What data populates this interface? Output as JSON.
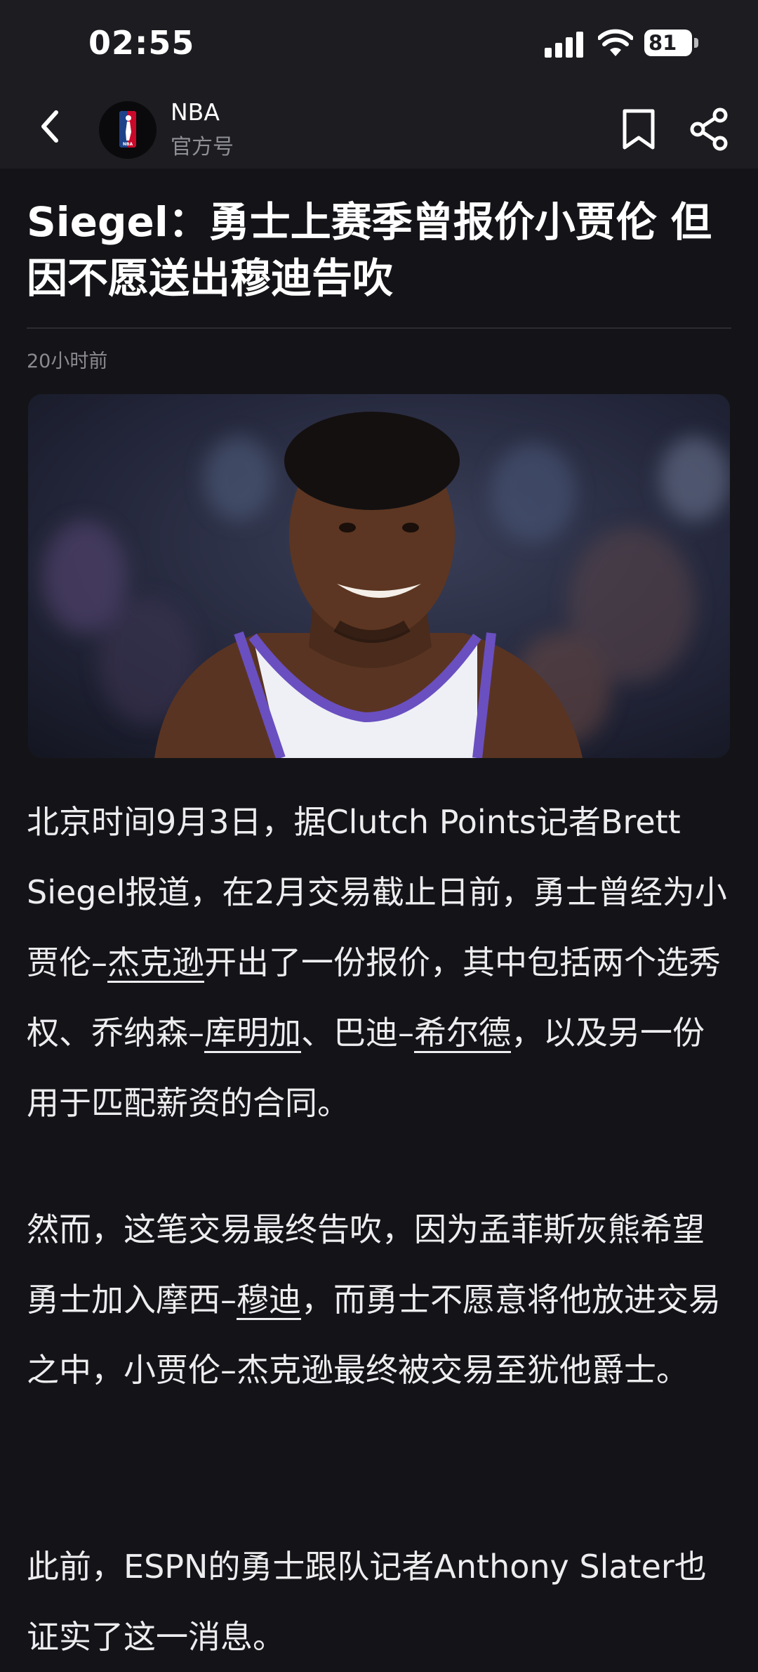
{
  "status_bar": {
    "time": "02:55",
    "battery": "81"
  },
  "nav": {
    "title": "NBA",
    "subtitle": "官方号",
    "logo_text": "NBA"
  },
  "article": {
    "headline": "Siegel：勇士上赛季曾报价小贾伦  但因不愿送出穆迪告吹",
    "timestamp": "20小时前",
    "p1": {
      "t1": "北京时间9月3日，据Clutch Points记者Brett Siegel报道，在2月交易截止日前，勇士曾经为小贾伦–",
      "l1": "杰克逊",
      "t2": "开出了一份报价，其中包括两个选秀权、乔纳森–",
      "l2": "库明加",
      "t3": "、巴迪–",
      "l3": "希尔德",
      "t4": "，以及另一份用于匹配薪资的合同。"
    },
    "p2": {
      "t1": "然而，这笔交易最终告吹，因为孟菲斯灰熊希望勇士加入摩西–",
      "l1": "穆迪",
      "t2": "，而勇士不愿意将他放进交易之中，小贾伦–杰克逊最终被交易至犹他爵士。"
    },
    "p3": {
      "t1": "此前，ESPN的勇士跟队记者Anthony Slater也证实了这一消息。"
    }
  },
  "colors": {
    "background": "#141418",
    "bar": "#1c1c21",
    "text": "#ededef",
    "muted": "#8a8a90"
  },
  "icons": [
    "back-icon",
    "nba-logo",
    "bookmark-icon",
    "share-icon",
    "signal-icon",
    "wifi-icon",
    "battery-icon"
  ]
}
